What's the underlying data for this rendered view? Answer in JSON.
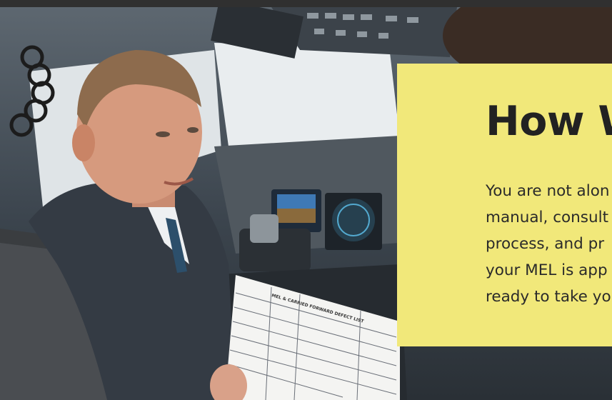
{
  "hero": {
    "image_icon": "pilot-in-cockpit-photo",
    "document_heading": "MEL & CARRIED FORWARD DEFECT LIST"
  },
  "card": {
    "background_color": "#f1e87a",
    "title": "How W",
    "body_lines": [
      "You are not alon",
      "manual, consult",
      "process, and pr",
      "your MEL is app",
      "ready to take yo"
    ]
  }
}
